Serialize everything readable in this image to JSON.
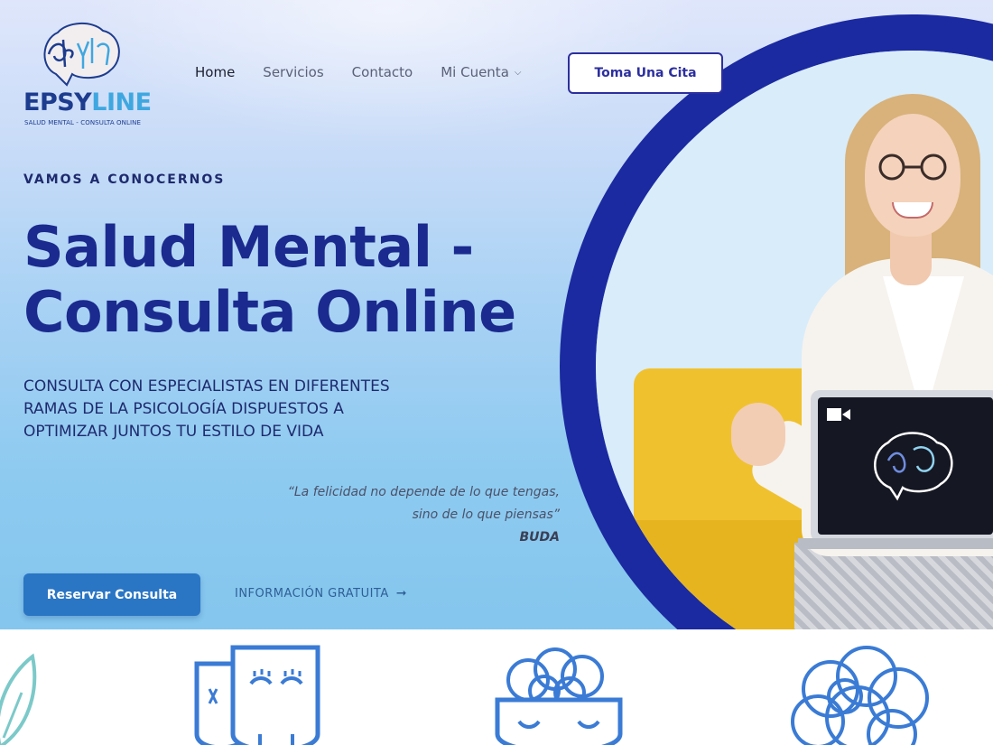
{
  "brand": {
    "name_part1": "EPSY",
    "name_part2": "LINE",
    "tagline": "SALUD MENTAL - CONSULTA ONLINE",
    "primary_color": "#1d3c8e",
    "accent_color": "#3fa7e0"
  },
  "nav": {
    "items": [
      {
        "label": "Home",
        "active": true
      },
      {
        "label": "Servicios"
      },
      {
        "label": "Contacto"
      },
      {
        "label": "Mi Cuenta",
        "has_dropdown": true
      }
    ],
    "cta_label": "Toma Una Cita"
  },
  "hero": {
    "eyebrow": "VAMOS A CONOCERNOS",
    "headline_line1": "Salud Mental -",
    "headline_line2": "Consulta Online",
    "subtext_line1": "CONSULTA CON ESPECIALISTAS EN DIFERENTES",
    "subtext_line2": "RAMAS DE LA PSICOLOGÍA DISPUESTOS A",
    "subtext_line3": "OPTIMIZAR JUNTOS TU ESTILO DE VIDA",
    "quote_line1": "“La felicidad no depende de lo que tengas,",
    "quote_line2": "sino de lo que piensas”",
    "quote_author": "BUDA",
    "primary_button": "Reservar Consulta",
    "secondary_link": "INFORMACIÓN GRATUITA",
    "ring_color": "#1b2aa0",
    "button_color": "#2a76c4"
  },
  "icons": [
    "leaf-icon",
    "theater-masks-icon",
    "brain-bowl-icon",
    "tangled-mind-icon"
  ]
}
